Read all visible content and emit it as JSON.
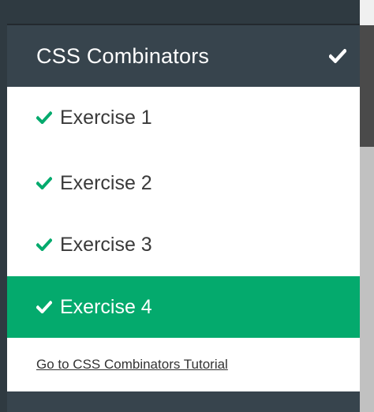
{
  "section": {
    "title": "CSS Combinators",
    "completed_icon": "check-icon"
  },
  "exercises": [
    {
      "label": "Exercise 1",
      "status_icon": "check-icon",
      "active": false
    },
    {
      "label": "Exercise 2",
      "status_icon": "check-icon",
      "active": false
    },
    {
      "label": "Exercise 3",
      "status_icon": "check-icon",
      "active": false
    },
    {
      "label": "Exercise 4",
      "status_icon": "check-icon",
      "active": true
    }
  ],
  "footer": {
    "tutorial_link": "Go to CSS Combinators Tutorial"
  },
  "colors": {
    "header_bg": "#37444d",
    "active_bg": "#04aa6d",
    "check_green": "#04aa6d",
    "text_dark": "#3a3a3a"
  }
}
